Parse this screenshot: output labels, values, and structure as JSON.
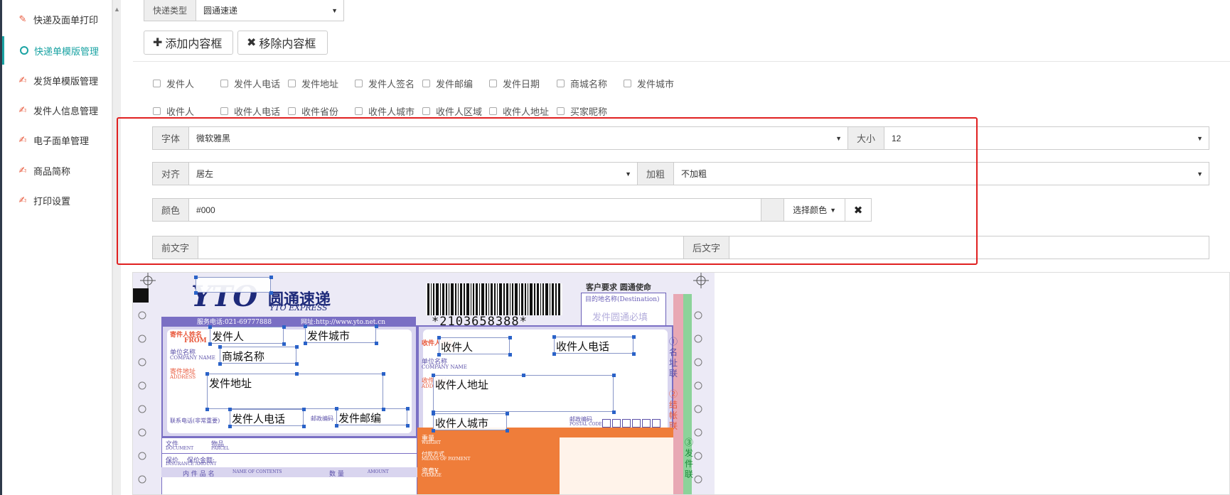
{
  "sidebar": {
    "items": [
      {
        "label": "快递及面单打印",
        "icon": "wand-icon",
        "active": false
      },
      {
        "label": "快递单模版管理",
        "icon": "circle-icon",
        "active": true
      },
      {
        "label": "发货单模版管理",
        "icon": "edit-icon",
        "active": false
      },
      {
        "label": "发件人信息管理",
        "icon": "edit-icon",
        "active": false
      },
      {
        "label": "电子面单管理",
        "icon": "edit-icon",
        "active": false
      },
      {
        "label": "商品简称",
        "icon": "edit-icon",
        "active": false
      },
      {
        "label": "打印设置",
        "icon": "edit-icon",
        "active": false
      }
    ]
  },
  "express_type": {
    "label": "快递类型",
    "value": "圆通速递"
  },
  "toolbar": {
    "add_label": "添加内容框",
    "remove_label": "移除内容框"
  },
  "sender_fields": [
    "发件人",
    "发件人电话",
    "发件地址",
    "发件人签名",
    "发件邮编",
    "发件日期",
    "商城名称",
    "发件城市"
  ],
  "receiver_fields": [
    "收件人",
    "收件人电话",
    "收件省份",
    "收件人城市",
    "收件人区域",
    "收件人地址",
    "买家昵称"
  ],
  "format": {
    "font_label": "字体",
    "font_value": "微软雅黑",
    "size_label": "大小",
    "size_value": "12",
    "align_label": "对齐",
    "align_value": "居左",
    "bold_label": "加粗",
    "bold_value": "不加粗",
    "color_label": "颜色",
    "color_value": "#000",
    "color_button": "选择颜色",
    "prefix_label": "前文字",
    "suffix_label": "后文字"
  },
  "waybill": {
    "brand_cn": "圆通速递",
    "brand_en": "YTO EXPRESS",
    "barcode_number": "*2103658388*",
    "slogan": "客户要求  圆通使命",
    "destination_label": "目的地名称(Destination)",
    "stamp": "发件圆通必填",
    "service_phone": "服务电话:021-69777888",
    "website": "网址:http://www.yto.net.cn",
    "from_label": "寄件人姓名",
    "from_en": "FROM",
    "to_label": "收件人姓名",
    "to_en": "TO",
    "company_label": "单位名称",
    "company_en": "COMPANY NAME",
    "address_label": "寄件地址",
    "address_en": "ADDRESS",
    "address_label2": "收件地址",
    "phone_label": "联系电话(非常重要)",
    "postal_label": "邮政编码",
    "postal_en": "POSTAL CODE",
    "doc_label": "文件",
    "doc_en": "DOCUMENT",
    "parcel_label": "物品",
    "parcel_en": "PARCEL",
    "insured_label": "保价",
    "insured_amount": "保价金额:",
    "insured_en": "INSURANCE AMOUNT",
    "contents_label": "内 件 品 名",
    "contents_en": "NAME OF CONTENTS",
    "qty_label": "数  量",
    "qty_en": "AMOUNT",
    "weight_label": "重量",
    "weight_en": "WEIGHT",
    "payment_label": "付款方式",
    "payment_en": "MEANS OF PAYMENT",
    "charge_label": "资费¥",
    "charge_en": "CHARGE",
    "side_copies": [
      "①名址联",
      "②结帐联",
      "③发件联"
    ],
    "fields": [
      "发件人",
      "发件城市",
      "商城名称",
      "发件地址",
      "发件人电话",
      "发件邮编",
      "收件人",
      "收件人电话",
      "收件人地址",
      "收件人城市"
    ]
  }
}
